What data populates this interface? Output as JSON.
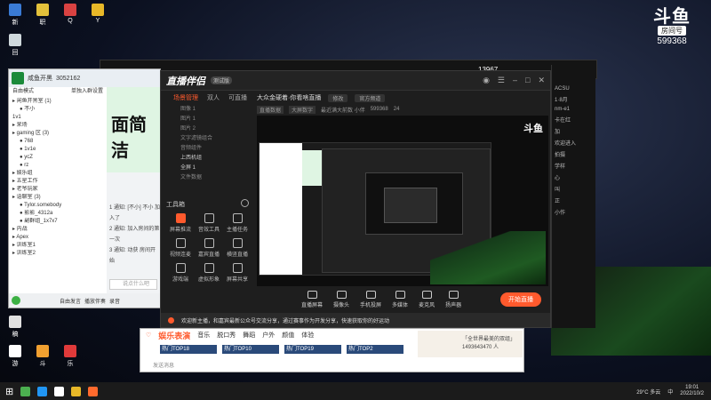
{
  "desktop": {
    "icons": [
      {
        "label": "新",
        "color": "#3a7bd5"
      },
      {
        "label": "职",
        "color": "#e3c13b"
      },
      {
        "label": "Q",
        "color": "#d94242"
      },
      {
        "label": "Y",
        "color": "#e8b828"
      },
      {
        "label": "回",
        "color": "#cfd8dc"
      },
      {
        "label": "稿",
        "color": "#e0e0e0"
      },
      {
        "label": "游",
        "color": "#ffffff"
      },
      {
        "label": "斗",
        "color": "#f0a030"
      },
      {
        "label": "乐",
        "color": "#e03a3a"
      }
    ]
  },
  "room_badge": {
    "logo": "斗鱼",
    "tag": "房间号",
    "number": "599368"
  },
  "top_strip": {
    "counter": "13967"
  },
  "chat_app": {
    "title": "咸鱼开黑",
    "id": "3052162",
    "subtitle": "自由模式",
    "hint": "单独入群设置",
    "rows": [
      "▸ 闲鱼开黑室 (1)",
      "● 不小 ",
      "1v1",
      "▸ 呆场",
      "▸ gaming 区 (3)",
      "● 768 ",
      "● 1v1e ",
      "● ycZ ",
      "● rz ",
      "▸ 娱乐组",
      "▸ 五星工作",
      "▸ 老爷玩家",
      "▸ 语聊室 (3)",
      "● Tylor.somebody ",
      "● 影影_4312a ",
      "● 副群组_1x7x7 ",
      "▸ 内战",
      "▸ Apex",
      "▸ 训练室1",
      "▸ 训练室2"
    ],
    "messages": [
      "1 通知: [不小] 不小 加入了",
      "2 通知: 加入房间的第一次 ",
      "3 通知: 动获 房间开始 "
    ],
    "input_placeholder": "说点什么吧",
    "bottom_labels": [
      "自由发言",
      "播放伴奏",
      "录音"
    ],
    "banner_text": "面简洁"
  },
  "stream_app": {
    "logo": "直播伴侣",
    "version": "测试版",
    "tabs": [
      "场景管理",
      "双人",
      "可直播"
    ],
    "sources": [
      "图像 1",
      "图片 1",
      "图片 2",
      "文字滤镜组合",
      "音频组件",
      "上西机组",
      "全屏 1",
      "文件数据"
    ],
    "title": "大众金硬着·你看啥直播",
    "pills": [
      "修改",
      "官方频道"
    ],
    "info": [
      "直播数据",
      "大屏数字",
      "最近满大前数 小伴",
      "599368",
      "24"
    ],
    "tools_header": "工具箱",
    "tools": [
      {
        "label": "屏幕推流",
        "hot": true
      },
      {
        "label": "音效工具",
        "hot": false
      },
      {
        "label": "主播任务",
        "hot": false
      },
      {
        "label": "视频连麦",
        "hot": false
      },
      {
        "label": "嘉宾直播",
        "hot": false
      },
      {
        "label": "横竖直播",
        "hot": false
      },
      {
        "label": "游戏端",
        "hot": false
      },
      {
        "label": "虚拟形象",
        "hot": false
      },
      {
        "label": "屏幕共享",
        "hot": false
      }
    ],
    "bottom_items": [
      "直播屏幕",
      "摄像头",
      "手机投屏",
      "多媒体",
      "麦克风",
      "扬声器"
    ],
    "live_button": "开始直播",
    "status_tip": "欢迎新主播，和嘉宾最新公众号交流分享，通过赛事作为开发分享，快速获取你的好运动",
    "watermark": "斗鱼"
  },
  "right_win": {
    "lines": [
      "ACSU",
      "1·8月",
      "nm-e1",
      "卡在红",
      "加",
      "欢迎进入",
      "拍摄",
      "学样",
      "心",
      "叫",
      "正",
      "小作"
    ]
  },
  "browser": {
    "brand": "娱乐表演",
    "nav": [
      "音乐",
      "脱口秀",
      "舞蹈",
      "户外",
      "颜值",
      "体验"
    ],
    "cards": [
      "热门TOP18",
      "热门TOP10",
      "热门TOP19",
      "热门TOP2"
    ],
    "side_card_title": "「全世界最美的双组」",
    "side_card_sub": "1493643470 人",
    "input_label": "发送消息"
  },
  "taskbar": {
    "weather": "29°C 多云",
    "ime": "中",
    "time": "19:01",
    "date": "2022/10/2"
  }
}
